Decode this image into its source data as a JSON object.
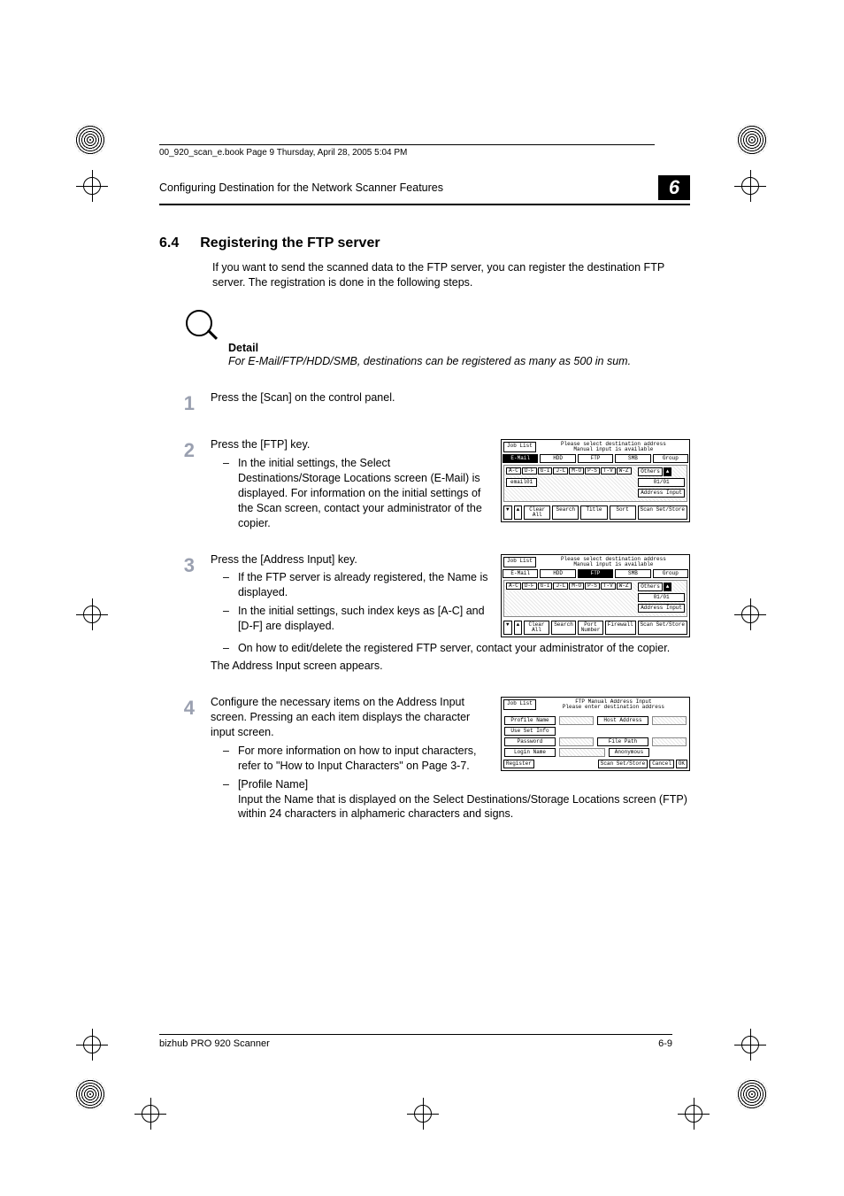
{
  "print_note": "00_920_scan_e.book  Page 9  Thursday, April 28, 2005  5:04 PM",
  "header": {
    "running_title": "Configuring Destination for the Network Scanner Features",
    "chapter_num": "6"
  },
  "section": {
    "number": "6.4",
    "title": "Registering the FTP server",
    "intro": "If you want to send the scanned data to the FTP server, you can register the destination FTP server. The registration is done in the following steps."
  },
  "detail": {
    "label": "Detail",
    "text": "For E-Mail/FTP/HDD/SMB, destinations can be registered as many as 500 in sum."
  },
  "steps": {
    "s1": {
      "num": "1",
      "text": "Press the [Scan] on the control panel."
    },
    "s2": {
      "num": "2",
      "text": "Press the [FTP] key.",
      "sub1": "In the initial settings, the Select Destinations/Storage Locations screen (E-Mail) is displayed. For information on the initial settings of the Scan screen, contact your administrator of the copier."
    },
    "s3": {
      "num": "3",
      "text": "Press the [Address Input] key.",
      "sub1": "If the FTP server is already registered, the Name is displayed.",
      "sub2": "In the initial settings, such index keys as [A-C] and [D-F] are displayed.",
      "sub3": "On how to edit/delete the registered FTP server, contact your administrator of the copier.",
      "tail": "The Address Input screen appears."
    },
    "s4": {
      "num": "4",
      "text": "Configure the necessary items on the Address Input screen. Pressing an each item displays the character input screen.",
      "sub1": "For more information on how to input characters, refer to \"How to Input Characters\" on Page 3-7.",
      "sub2_label": "[Profile Name]",
      "sub2_text": "Input the Name that is displayed on the Select Destinations/Storage Locations screen (FTP) within 24 characters in alphameric characters and signs."
    }
  },
  "screenshots": {
    "a": {
      "joblist": "Job List",
      "msg1": "Please select destination address",
      "msg2": "Manual input is available",
      "tabs": [
        "E-Mail",
        "HDD",
        "FTP",
        "SMB",
        "Group"
      ],
      "idx": [
        "A-C",
        "D-F",
        "G-I",
        "J-L",
        "M-O",
        "P-S",
        "T-V",
        "W-Z"
      ],
      "entry": "email01",
      "others": "Others",
      "page": "01/01",
      "addr": "Address Input",
      "bottom_arrows_l": "▼",
      "bottom_arrows_r": "▲",
      "clear": "Clear All",
      "search": "Search",
      "title": "Title",
      "sort": "Sort",
      "store": "Scan Set/Store"
    },
    "b": {
      "joblist": "Job List",
      "msg1": "Please select destination address",
      "msg2": "Manual input is available",
      "tabs": [
        "E-Mail",
        "HDD",
        "FTP",
        "SMB",
        "Group"
      ],
      "idx": [
        "A-C",
        "D-F",
        "G-I",
        "J-L",
        "M-O",
        "P-S",
        "T-V",
        "W-Z"
      ],
      "others": "Others",
      "page": "01/01",
      "addr": "Address Input",
      "clear": "Clear All",
      "search": "Search",
      "port": "Port Number",
      "firewall": "Firewall",
      "store": "Scan Set/Store"
    },
    "c": {
      "joblist": "Job List",
      "msg1": "FTP Manual Address Input",
      "msg2": "Please enter destination address",
      "profile": "Profile Name",
      "host": "Host Address",
      "useset": "Use Set Info",
      "password": "Password",
      "filepath": "File Path",
      "login": "Login Name",
      "anon": "Anonymous",
      "register": "Register",
      "store": "Scan Set/Store",
      "cancel": "Cancel",
      "ok": "OK"
    }
  },
  "footer": {
    "product": "bizhub PRO 920 Scanner",
    "page": "6-9"
  }
}
